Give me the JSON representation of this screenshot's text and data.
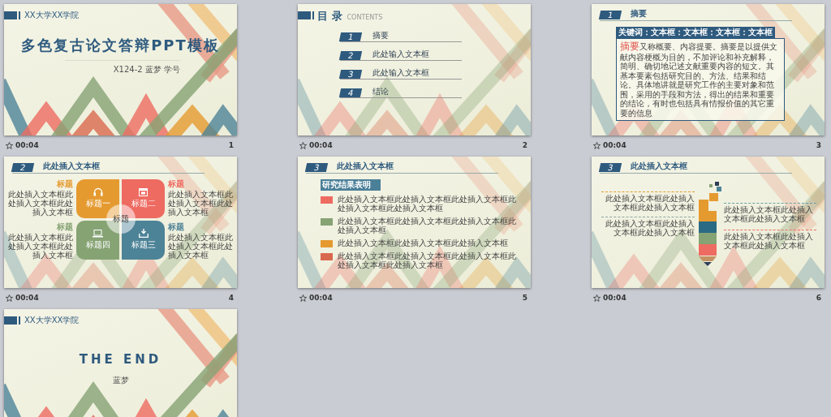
{
  "slides": [
    {
      "kind": "title",
      "number": "1",
      "timing": "00:04",
      "school": "XX大学XX学院",
      "title": "多色复古论文答辩PPT模板",
      "subtitle": "X124-2 蓝梦 学号"
    },
    {
      "kind": "contents",
      "number": "2",
      "timing": "00:04",
      "heading": "目 录",
      "heading_en": "CONTENTS",
      "items": [
        {
          "index": "1",
          "label": "摘要"
        },
        {
          "index": "2",
          "label": "此处输入文本框"
        },
        {
          "index": "3",
          "label": "此处输入文本框"
        },
        {
          "index": "4",
          "label": "结论"
        }
      ]
    },
    {
      "kind": "abstract",
      "number": "3",
      "timing": "00:04",
      "section": {
        "index": "1",
        "title": "摘要"
      },
      "keywords": "关键词：文本框：文本框：文本框：文本框",
      "lead": "摘要",
      "body": "又称概要、内容提要。摘要是以提供文献内容梗概为目的，不加评论和补充解释，简明、确切地记述文献重要内容的短文。其基本要素包括研究目的、方法、结果和结论。具体地讲就是研究工作的主要对象和范围，采用的手段和方法，得出的结果和重要的结论，有时也包括具有情报价值的其它重要的信息"
    },
    {
      "kind": "quad",
      "number": "4",
      "timing": "00:04",
      "section": {
        "index": "2",
        "title": "此处插入文本框"
      },
      "center": "标题",
      "tiles": [
        {
          "label": "标题一",
          "color": "#e59a30"
        },
        {
          "label": "标题二",
          "color": "#ee6b62"
        },
        {
          "label": "标题四",
          "color": "#86a374"
        },
        {
          "label": "标题三",
          "color": "#4d8397"
        }
      ],
      "notes": [
        {
          "title": "标题",
          "text": "此处插入文本框此处插入文本框此处插入文本框",
          "color": "#e59a30"
        },
        {
          "title": "标题",
          "text": "此处插入文本框此处插入文本框此处插入文本框",
          "color": "#ee6b62"
        },
        {
          "title": "标题",
          "text": "此处插入文本框此处插入文本框此处插入文本框",
          "color": "#86a374"
        },
        {
          "title": "标题",
          "text": "此处插入文本框此处插入文本框此处插入文本框",
          "color": "#4d8397"
        }
      ]
    },
    {
      "kind": "list",
      "number": "5",
      "timing": "00:04",
      "section": {
        "index": "3",
        "title": "此处插入文本框"
      },
      "tag": "研究结果表明",
      "rows": [
        {
          "color": "#ee6b62",
          "text": "此处插入文本框此处插入文本框此处插入文本框此处插入文本框此处插入文本框"
        },
        {
          "color": "#86a374",
          "text": "此处插入文本框此处插入文本框此处插入文本框此处插入文本框"
        },
        {
          "color": "#e59a30",
          "text": "此处插入文本框此处插入文本框此处插入文本框"
        },
        {
          "color": "#d9694e",
          "text": "此处插入文本框此处插入文本框此处插入文本框此处插入文本框此处插入文本框"
        }
      ]
    },
    {
      "kind": "pencil",
      "number": "6",
      "timing": "00:04",
      "section": {
        "index": "3",
        "title": "此处插入文本框"
      },
      "notes": [
        {
          "text": "此处插入文本框此处插入文本框此处插入文本框",
          "color": "#e59a30"
        },
        {
          "text": "此处插入文本框此处插入文本框此处插入文本框",
          "color": "#6a9fa8"
        },
        {
          "text": "此处插入文本框此处插入文本框此处插入文本框",
          "color": "#8aa9a0"
        },
        {
          "text": "此处插入文本框此处插入文本框此处插入文本框",
          "color": "#ee6b62"
        }
      ]
    },
    {
      "kind": "end",
      "school": "XX大学XX学院",
      "title": "THE END",
      "subtitle": "蓝梦"
    }
  ]
}
